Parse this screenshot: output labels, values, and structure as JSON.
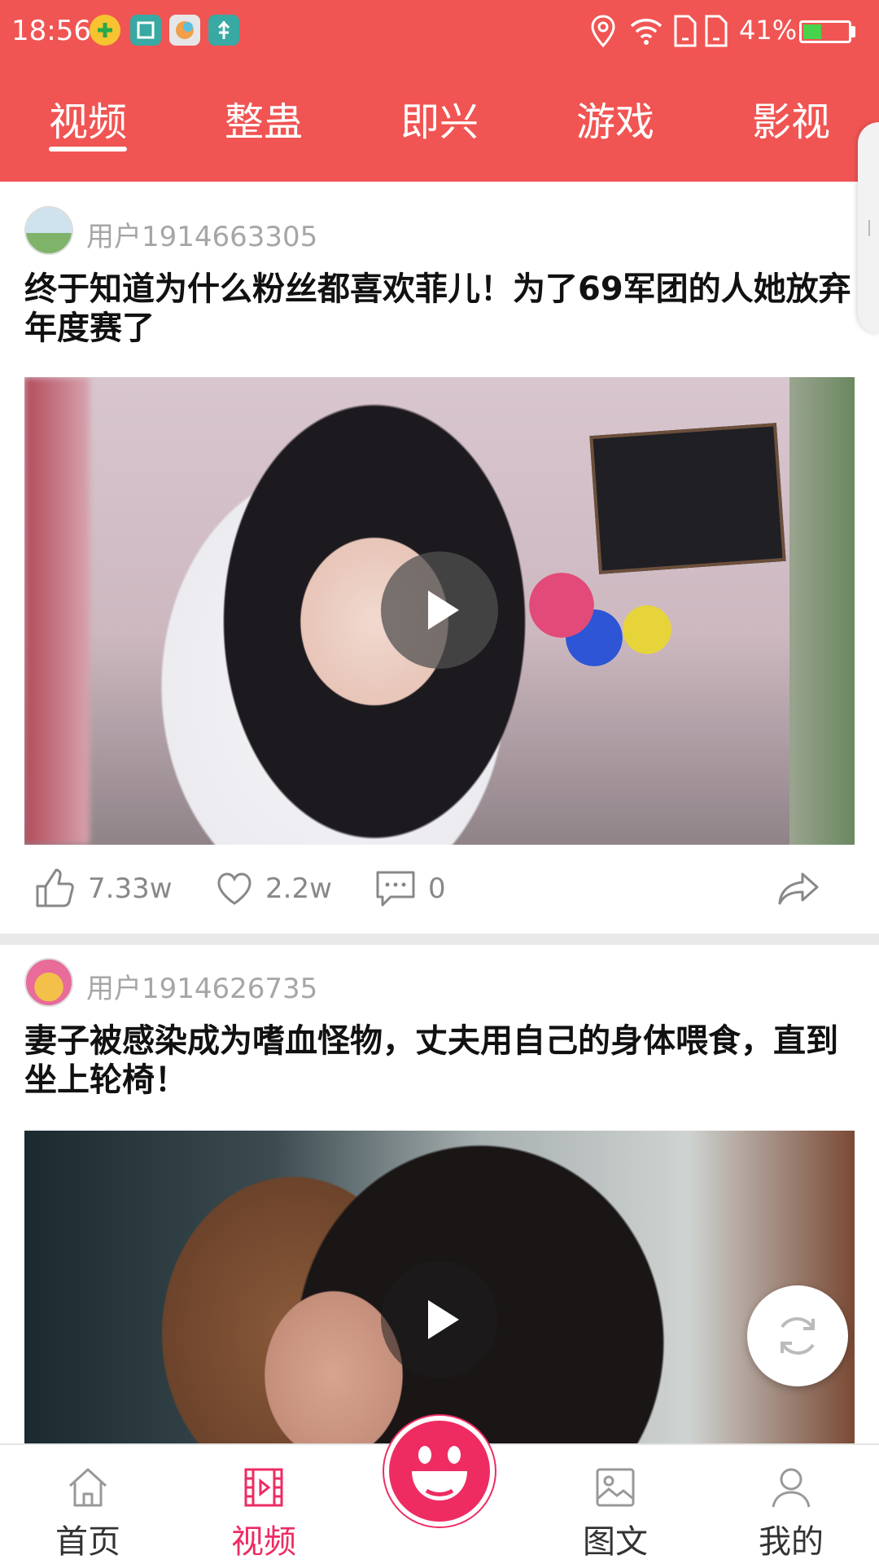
{
  "status_bar": {
    "time": "18:56",
    "battery_percent": "41%",
    "battery_level": 0.41,
    "icons": [
      "notification-plus-icon",
      "scan-icon",
      "app-icon",
      "usb-icon",
      "location-icon",
      "wifi-icon",
      "sim1-icon",
      "sim2-icon",
      "battery-icon"
    ]
  },
  "tabs": {
    "items": [
      "视频",
      "整蛊",
      "即兴",
      "游戏",
      "影视"
    ],
    "active_index": 0
  },
  "posts": [
    {
      "username": "用户1914663305",
      "title": "终于知道为什么粉丝都喜欢菲儿！为了69军团的人她放弃年度赛了",
      "likes": "7.33w",
      "favorites": "2.2w",
      "comments": "0"
    },
    {
      "username": "用户1914626735",
      "title": "妻子被感染成为嗜血怪物，丈夫用自己的身体喂食，直到坐上轮椅！"
    }
  ],
  "bottom_nav": {
    "items": [
      "首页",
      "视频",
      "图文",
      "我的"
    ],
    "active": "视频"
  },
  "colors": {
    "brand_red": "#f05553",
    "active_pink": "#ee2c62",
    "text_gray": "#a6a6a6"
  }
}
